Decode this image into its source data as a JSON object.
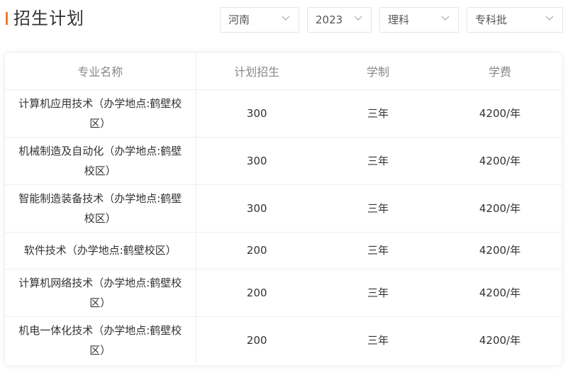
{
  "page_title": "招生计划",
  "filters": {
    "province": "河南",
    "year": "2023",
    "subject": "理科",
    "batch": "专科批"
  },
  "table": {
    "headers": [
      "专业名称",
      "计划招生",
      "学制",
      "学费"
    ],
    "rows": [
      {
        "major": "计算机应用技术（办学地点:鹤壁校区）",
        "plan": "300",
        "duration": "三年",
        "fee": "4200/年"
      },
      {
        "major": "机械制造及自动化（办学地点:鹤壁校区）",
        "plan": "300",
        "duration": "三年",
        "fee": "4200/年"
      },
      {
        "major": "智能制造装备技术（办学地点:鹤壁校区）",
        "plan": "300",
        "duration": "三年",
        "fee": "4200/年"
      },
      {
        "major": "软件技术（办学地点:鹤壁校区）",
        "plan": "200",
        "duration": "三年",
        "fee": "4200/年"
      },
      {
        "major": "计算机网络技术（办学地点:鹤壁校区）",
        "plan": "200",
        "duration": "三年",
        "fee": "4200/年"
      },
      {
        "major": "机电一体化技术（办学地点:鹤壁校区）",
        "plan": "200",
        "duration": "三年",
        "fee": "4200/年"
      }
    ]
  },
  "colors": {
    "accent": "#f07c2a",
    "border": "#eeeeee",
    "header_text": "#888888"
  }
}
